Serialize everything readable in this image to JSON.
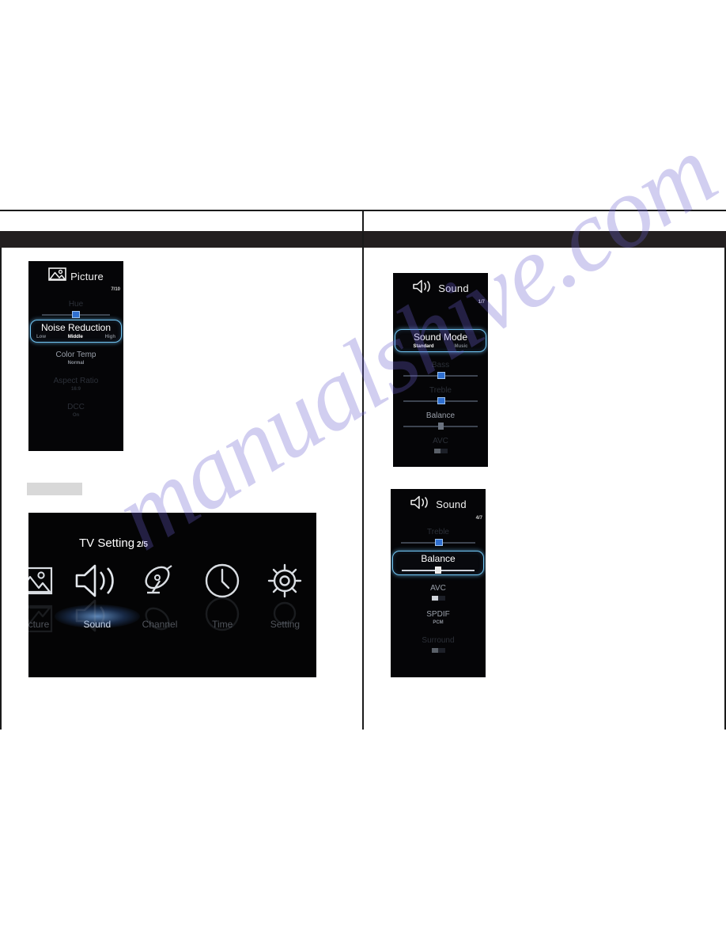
{
  "watermark": {
    "text": "manualshive.com"
  },
  "panels": {
    "picture": {
      "title": "Picture",
      "icon": "picture-icon",
      "counter": "7/10",
      "rows": [
        {
          "label": "Hue",
          "type": "slider",
          "state": "dim"
        },
        {
          "label": "Noise Reduction",
          "type": "options",
          "state": "selected",
          "options": [
            {
              "label": "Low",
              "active": false
            },
            {
              "label": "Middle",
              "active": true
            },
            {
              "label": "High",
              "active": false
            }
          ]
        },
        {
          "label": "Color Temp",
          "value": "Normal",
          "type": "value",
          "state": "bright"
        },
        {
          "label": "Aspect Ratio",
          "value": "16:9",
          "type": "value",
          "state": "dim"
        },
        {
          "label": "DCC",
          "value": "On",
          "type": "value",
          "state": "dim"
        }
      ]
    },
    "sound_1": {
      "title": "Sound",
      "icon": "speaker-icon",
      "counter": "1/7",
      "rows": [
        {
          "label": "Sound Mode",
          "type": "options",
          "state": "selected",
          "options": [
            {
              "label": "Standard",
              "active": true
            },
            {
              "label": "Music",
              "active": false
            }
          ]
        },
        {
          "label": "Bass",
          "type": "slider",
          "state": "dim"
        },
        {
          "label": "Treble",
          "type": "slider",
          "state": "dim"
        },
        {
          "label": "Balance",
          "type": "slider",
          "state": "bright"
        },
        {
          "label": "AVC",
          "type": "toggle",
          "state": "dim"
        }
      ]
    },
    "sound_2": {
      "title": "Sound",
      "icon": "speaker-icon",
      "counter": "4/7",
      "rows": [
        {
          "label": "Treble",
          "type": "slider",
          "state": "dim"
        },
        {
          "label": "Balance",
          "type": "slider",
          "state": "selected"
        },
        {
          "label": "AVC",
          "type": "toggle",
          "state": "bright"
        },
        {
          "label": "SPDIF",
          "value": "PCM",
          "type": "value",
          "state": "bright"
        },
        {
          "label": "Surround",
          "type": "toggle",
          "state": "dim"
        }
      ]
    }
  },
  "tv_setting": {
    "title": "TV Setting",
    "counter": "2/5",
    "items": [
      {
        "label": "Picture",
        "icon": "picture-icon",
        "active": false
      },
      {
        "label": "Sound",
        "icon": "speaker-icon",
        "active": true
      },
      {
        "label": "Channel",
        "icon": "satellite-dish-icon",
        "active": false
      },
      {
        "label": "Time",
        "icon": "clock-icon",
        "active": false
      },
      {
        "label": "Setting",
        "icon": "gear-icon",
        "active": false
      }
    ]
  }
}
